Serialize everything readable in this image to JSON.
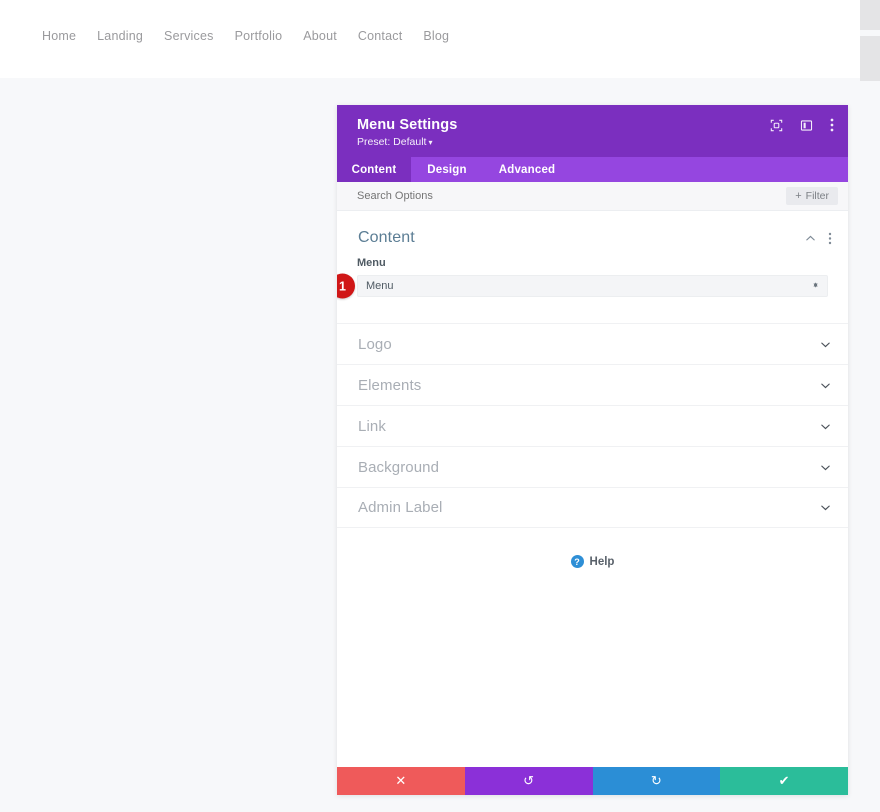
{
  "site": {
    "nav_items": [
      {
        "label": "Home"
      },
      {
        "label": "Landing"
      },
      {
        "label": "Services"
      },
      {
        "label": "Portfolio"
      },
      {
        "label": "About"
      },
      {
        "label": "Contact"
      },
      {
        "label": "Blog"
      }
    ]
  },
  "modal": {
    "title": "Menu Settings",
    "preset_label": "Preset: Default",
    "preset_caret": "▾",
    "header_icons": [
      {
        "name": "focus-target-icon"
      },
      {
        "name": "panel-layout-icon"
      },
      {
        "name": "more-options-icon"
      }
    ],
    "tabs": [
      {
        "label": "Content",
        "active": true
      },
      {
        "label": "Design",
        "active": false
      },
      {
        "label": "Advanced",
        "active": false
      }
    ],
    "search": {
      "placeholder": "Search Options",
      "value": ""
    },
    "filter_button": {
      "plus": "+",
      "label": "Filter"
    },
    "content_section": {
      "title": "Content",
      "collapse_icon": "⌃",
      "menu_icon": "⋮"
    },
    "menu_field": {
      "label": "Menu",
      "value": "Menu",
      "badge": "1",
      "badge_color": "#d01717",
      "up_arrow": "▲",
      "down_arrow": "▼"
    },
    "collapsed_sections": [
      {
        "label": "Logo"
      },
      {
        "label": "Elements"
      },
      {
        "label": "Link"
      },
      {
        "label": "Background"
      },
      {
        "label": "Admin Label"
      }
    ],
    "help": {
      "icon_char": "?",
      "label": "Help"
    },
    "footer_buttons": [
      {
        "name": "cancel-button",
        "glyph": "✕",
        "color": "#ef5a5a"
      },
      {
        "name": "undo-button",
        "glyph": "↺",
        "color": "#8b30d8"
      },
      {
        "name": "redo-button",
        "glyph": "↻",
        "color": "#2b8ed6"
      },
      {
        "name": "save-button",
        "glyph": "✔",
        "color": "#2bbd9a"
      }
    ]
  },
  "theme": {
    "header_purple": "#7b2fbf",
    "tabbar_purple": "#9546e0",
    "section_title_blue": "#5b7d94"
  }
}
